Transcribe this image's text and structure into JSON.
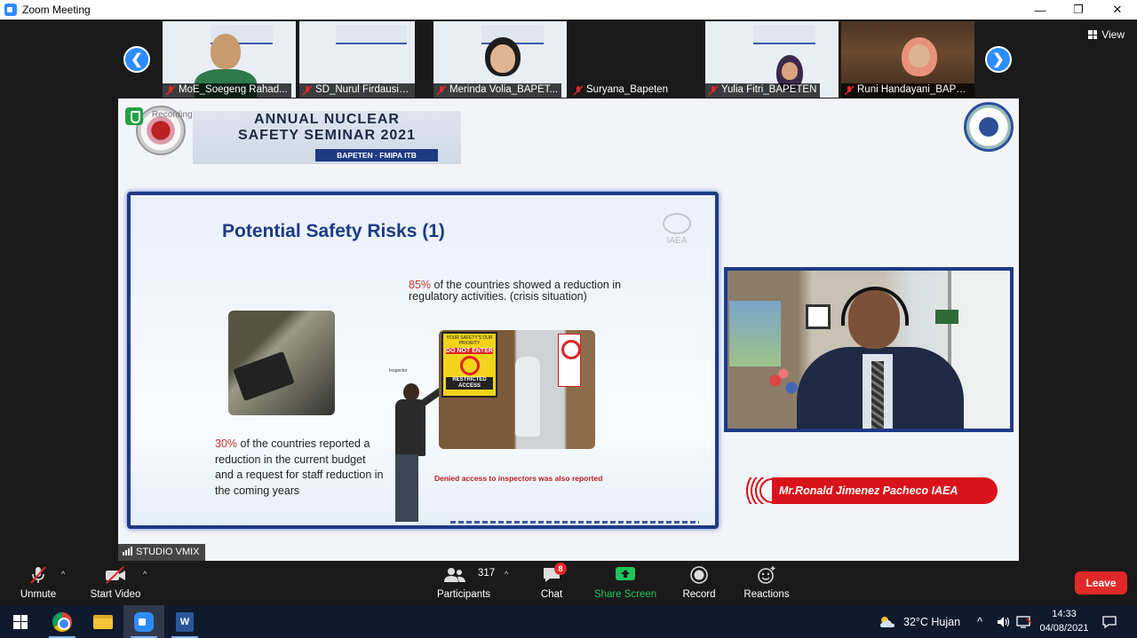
{
  "window": {
    "title": "Zoom Meeting"
  },
  "strip": {
    "thumbs": [
      {
        "name": "MoE_Soegeng Rahad..."
      },
      {
        "name": "SD_Nurul Firdausi Nu..."
      },
      {
        "name": "Merinda Volia_BAPET..."
      },
      {
        "name": "Suryana_Bapeten"
      },
      {
        "name": "Yulia Fitri_BAPETEN"
      },
      {
        "name": "Runi Handayani_BAPE..."
      }
    ],
    "view_label": "View"
  },
  "share": {
    "recording_label": "Recording",
    "banner": {
      "line1": "ANNUAL NUCLEAR",
      "line2": "SAFETY SEMINAR 2021",
      "line3": "BAPETEN · FMIPA ITB"
    },
    "slide": {
      "title": "Potential Safety Risks (1)",
      "iaea": "IAEA",
      "p85_highlight": "85%",
      "p85_text": " of the countries showed a reduction in regulatory activities. (crisis situation)",
      "p30_highlight": "30%",
      "p30_text": " of the countries reported a reduction in the current budget and a request for staff reduction in the coming years",
      "inspector_label": "Inspector",
      "sign_top": "YOUR SAFETY'S OUR PRIORITY",
      "sign_do_not": "DO NOT ENTER",
      "sign_restricted": "RESTRICTED ACCESS",
      "caption": "Denied access to inspectors was also reported"
    },
    "name_tag": "Mr.Ronald Jimenez Pacheco IAEA",
    "vmix_label": "STUDIO VMIX"
  },
  "toolbar": {
    "unmute": "Unmute",
    "start_video": "Start Video",
    "participants": "Participants",
    "participants_count": "317",
    "chat": "Chat",
    "chat_badge": "8",
    "share_screen": "Share Screen",
    "record": "Record",
    "reactions": "Reactions",
    "leave": "Leave"
  },
  "taskbar": {
    "weather": "32°C  Hujan",
    "time": "14:33",
    "date": "04/08/2021"
  },
  "colors": {
    "zoom_blue": "#2D8CFF",
    "leave_red": "#E02828",
    "share_green": "#22C35D",
    "slide_navy": "#1E3A86"
  }
}
